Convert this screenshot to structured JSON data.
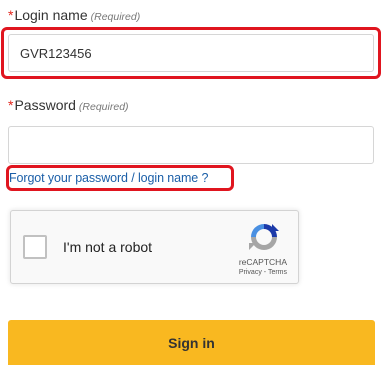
{
  "login": {
    "label": "Login name",
    "required_note": "(Required)",
    "required_mark": "*",
    "value": "GVR123456"
  },
  "password": {
    "label": "Password",
    "required_note": "(Required)",
    "required_mark": "*",
    "value": ""
  },
  "forgot_link": "Forgot your password / login name ?",
  "recaptcha": {
    "checkbox_label": "I'm not a robot",
    "brand": "reCAPTCHA",
    "privacy": "Privacy",
    "separator": " - ",
    "terms": "Terms"
  },
  "signin_button": "Sign in",
  "colors": {
    "highlight": "#e0151f",
    "link": "#1b5fa8",
    "button": "#f9b820",
    "required": "#e2231a"
  },
  "icons": {
    "recaptcha_logo": "recaptcha-logo-icon"
  }
}
